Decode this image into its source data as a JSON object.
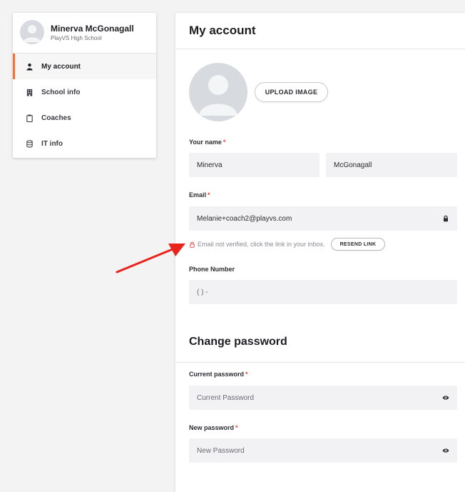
{
  "sidebar": {
    "profile": {
      "name": "Minerva McGonagall",
      "school": "PlayVS High School"
    },
    "items": [
      {
        "label": "My account",
        "icon": "person-icon",
        "active": true
      },
      {
        "label": "School info",
        "icon": "building-icon",
        "active": false
      },
      {
        "label": "Coaches",
        "icon": "clipboard-icon",
        "active": false
      },
      {
        "label": "IT info",
        "icon": "database-icon",
        "active": false
      }
    ]
  },
  "main": {
    "title": "My account",
    "upload_label": "UPLOAD IMAGE",
    "name_field": {
      "label": "Your name",
      "required_mark": "*",
      "first": "Minerva",
      "last": "McGonagall"
    },
    "email_field": {
      "label": "Email",
      "required_mark": "*",
      "value": "Melanie+coach2@playvs.com",
      "suffix_icon": "lock-icon"
    },
    "verify": {
      "message": "Email not verified, click the link in your inbox.",
      "resend_label": "RESEND LINK",
      "icon": "lock-icon"
    },
    "phone_field": {
      "label": "Phone Number",
      "value": "(  )  -"
    },
    "password_section": {
      "title": "Change password",
      "current": {
        "label": "Current password",
        "required_mark": "*",
        "placeholder": "Current Password",
        "suffix_icon": "eye-icon"
      },
      "new": {
        "label": "New password",
        "required_mark": "*",
        "placeholder": "New Password",
        "suffix_icon": "eye-icon"
      }
    }
  },
  "colors": {
    "accent": "#ff6b2c",
    "required": "#e0453a",
    "annotation_arrow": "#e8241c",
    "input_bg": "#f2f2f4",
    "avatar_bg": "#d7dadf"
  }
}
